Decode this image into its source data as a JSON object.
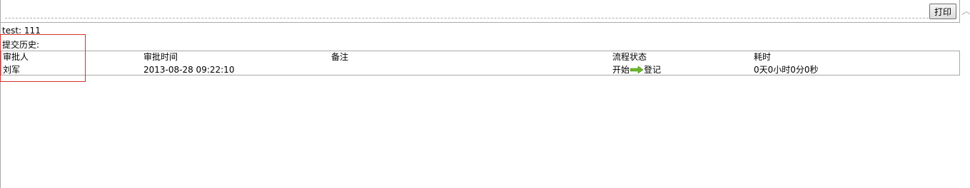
{
  "toolbar": {
    "print_label": "打印"
  },
  "form": {
    "field_label": "test:",
    "field_value": "111"
  },
  "history": {
    "title": "提交历史:",
    "columns": [
      "审批人",
      "审批时间",
      "备注",
      "流程状态",
      "耗时"
    ],
    "rows": [
      {
        "approver": "刘军",
        "time": "2013-08-28 09:22:10",
        "remark": "",
        "status_from": "开始",
        "status_to": "登记",
        "duration": "0天0小时0分0秒"
      }
    ]
  },
  "colors": {
    "arrow": "#6bb82a",
    "highlight": "#d4302a",
    "border": "#a9a9a9"
  },
  "icons": {
    "scroll_up": "chevron-up-icon",
    "status_arrow": "arrow-right-icon"
  }
}
